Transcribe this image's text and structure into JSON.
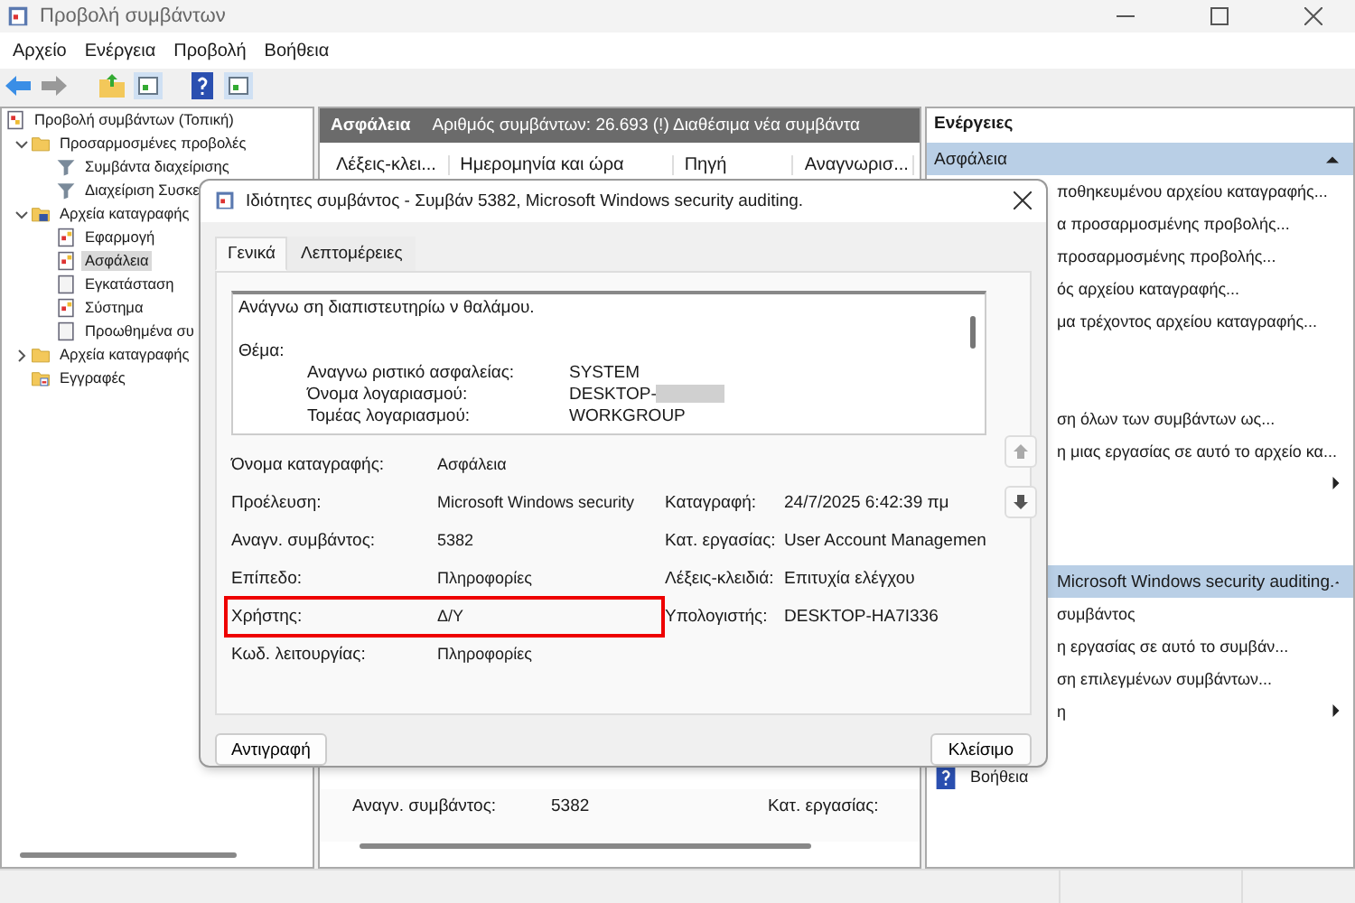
{
  "window": {
    "title": "Προβολή συμβάντων"
  },
  "menu": [
    "Αρχείο",
    "Ενέργεια",
    "Προβολή",
    "Βοήθεια"
  ],
  "tree": [
    {
      "label": "Προβολή συμβάντων (Τοπική)",
      "kind": "viewer",
      "selected": false,
      "children": [
        {
          "label": "Προσαρμοσμένες προβολές",
          "kind": "folder",
          "expanded": true,
          "selected": false,
          "children": [
            {
              "label": "Συμβάντα διαχείρισης",
              "kind": "filter",
              "selected": false
            },
            {
              "label": "Διαχείριση Συσκε",
              "kind": "filter",
              "selected": false
            }
          ]
        },
        {
          "label": "Αρχεία καταγραφής",
          "kind": "logfolder",
          "expanded": true,
          "selected": false,
          "children": [
            {
              "label": "Εφαρμογή",
              "kind": "log",
              "selected": false
            },
            {
              "label": "Ασφάλεια",
              "kind": "log",
              "selected": true
            },
            {
              "label": "Εγκατάσταση",
              "kind": "doc",
              "selected": false
            },
            {
              "label": "Σύστημα",
              "kind": "log",
              "selected": false
            },
            {
              "label": "Προωθημένα συ",
              "kind": "doc",
              "selected": false
            }
          ]
        },
        {
          "label": "Αρχεία καταγραφής",
          "kind": "folder",
          "expanded": false,
          "selected": false
        },
        {
          "label": "Εγγραφές",
          "kind": "subs",
          "selected": false
        }
      ]
    }
  ],
  "log_panel": {
    "title": "Ασφάλεια",
    "info": "Αριθμός συμβάντων: 26.693 (!) Διαθέσιμα νέα συμβάντα",
    "columns": [
      "Λέξεις-κλει...",
      "Ημερομηνία και ώρα",
      "Πηγή",
      "Αναγνωρισ..."
    ],
    "preview": [
      {
        "label": "Αναγν. συμβάντος:",
        "value": "5382",
        "right_label": "Κατ. εργασίας:"
      }
    ]
  },
  "actions": {
    "title": "Ενέργειες",
    "groups": [
      {
        "header": "Ασφάλεια",
        "expanded": true,
        "items": [
          {
            "text": "ποθηκευμένου αρχείου καταγραφής...",
            "submenu": false
          },
          {
            "text": "α προσαρμοσμένης προβολής...",
            "submenu": false
          },
          {
            "text": "προσαρμοσμένης προβολής...",
            "submenu": false
          },
          {
            "text": "ός αρχείου καταγραφής...",
            "submenu": false
          },
          {
            "text": "μα τρέχοντος αρχείου καταγραφής...",
            "submenu": false
          },
          {
            "submenu": false
          },
          {
            "submenu": false
          },
          {
            "text": "ση όλων των συμβάντων ως...",
            "submenu": false
          },
          {
            "text": "η μιας εργασίας σε αυτό το αρχείο κα...",
            "submenu": false
          },
          {
            "submenu": true
          },
          {
            "submenu": false
          },
          {
            "submenu": false
          }
        ]
      },
      {
        "header": "Microsoft Windows security auditing.",
        "expanded": true,
        "items": [
          {
            "text": "συμβάντος",
            "submenu": false
          },
          {
            "text": "η εργασίας σε αυτό το συμβάν...",
            "submenu": false
          },
          {
            "text": "ση επιλεγμένων συμβάντων...",
            "submenu": false
          },
          {
            "text": "η",
            "submenu": true
          },
          {
            "submenu": false
          },
          {
            "text": "Βοήθεια",
            "submenu": false,
            "kind": "help"
          }
        ]
      }
    ]
  },
  "dialog": {
    "title": "Ιδιότητες συμβάντος - Συμβάν 5382, Microsoft Windows security auditing.",
    "tabs": [
      {
        "label": "Γενικά",
        "selected": true
      },
      {
        "label": "Λεπτομέρειες",
        "selected": false
      }
    ],
    "description": {
      "text": "Ανάγνω ση διαπιστευτηρίω ν θαλάμου.",
      "subject": "Θέμα:",
      "rows": [
        {
          "label": "Αναγνω ριστικό ασφαλείας:",
          "value": "SYSTEM",
          "redacted": false
        },
        {
          "label": "Όνομα λογαριασμού:",
          "value": "DESKTOP-",
          "redacted": true
        },
        {
          "label": "Τομέας λογαριασμού:",
          "value": "WORKGROUP",
          "redacted": false
        }
      ]
    },
    "fields": [
      {
        "label": "Όνομα καταγραφής:",
        "value": "Ασφάλεια",
        "highlighted": false
      },
      {
        "label": "Προέλευση:",
        "value": "Microsoft Windows security",
        "right_label": "Καταγραφή:",
        "right_value": "24/7/2025 6:42:39 πμ",
        "highlighted": false
      },
      {
        "label": "Αναγν. συμβάντος:",
        "value": "5382",
        "right_label": "Κατ. εργασίας:",
        "right_value": "User Account Managemen",
        "highlighted": false
      },
      {
        "label": "Επίπεδο:",
        "value": "Πληροφορίες",
        "right_label": "Λέξεις-κλειδιά:",
        "right_value": "Επιτυχία ελέγχου",
        "highlighted": false
      },
      {
        "label": "Χρήστης:",
        "value": "Δ/Υ",
        "right_label": "Υπολογιστής:",
        "right_value": "DESKTOP-HA7I336",
        "highlighted": true
      },
      {
        "label": "Κωδ. λειτουργίας:",
        "value": "Πληροφορίες",
        "highlighted": false
      }
    ],
    "buttons": [
      "Αντιγραφή",
      "Κλείσιμο"
    ]
  }
}
